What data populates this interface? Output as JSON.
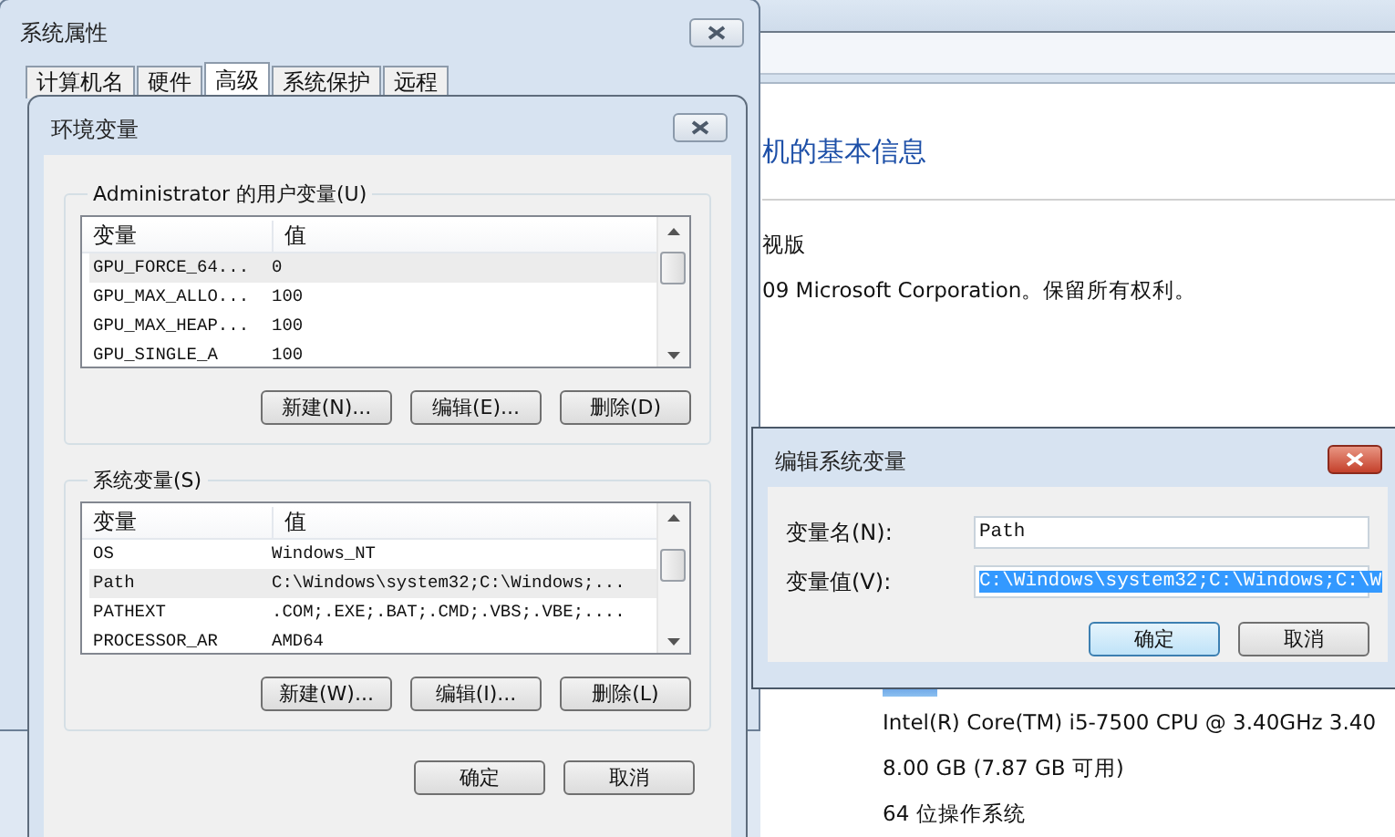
{
  "background_window": {
    "heading": "机的基本信息",
    "edition": "视版",
    "copyright": "09 Microsoft Corporation。保留所有权利。",
    "specs": [
      "Intel(R) Core(TM) i5-7500 CPU @ 3.40GHz   3.40",
      "8.00 GB (7.87 GB 可用)",
      "64 位操作系统"
    ]
  },
  "system_properties": {
    "title": "系统属性",
    "tabs": [
      {
        "label": "计算机名",
        "selected": false
      },
      {
        "label": "硬件",
        "selected": false
      },
      {
        "label": "高级",
        "selected": true
      },
      {
        "label": "系统保护",
        "selected": false
      },
      {
        "label": "远程",
        "selected": false
      }
    ]
  },
  "environment_variables": {
    "title": "环境变量",
    "groups": [
      {
        "title": "Administrator 的用户变量(U)",
        "columns": [
          "变量",
          "值"
        ],
        "rows": [
          {
            "name": "GPU_FORCE_64...",
            "value": "0",
            "selected": true
          },
          {
            "name": "GPU_MAX_ALLO...",
            "value": "100",
            "selected": false
          },
          {
            "name": "GPU_MAX_HEAP...",
            "value": "100",
            "selected": false
          },
          {
            "name": "GPU_SINGLE_A",
            "value": "100",
            "selected": false
          }
        ],
        "buttons": [
          "新建(N)...",
          "编辑(E)...",
          "删除(D)"
        ]
      },
      {
        "title": "系统变量(S)",
        "columns": [
          "变量",
          "值"
        ],
        "rows": [
          {
            "name": "OS",
            "value": "Windows_NT",
            "selected": false
          },
          {
            "name": "Path",
            "value": "C:\\Windows\\system32;C:\\Windows;...",
            "selected": true
          },
          {
            "name": "PATHEXT",
            "value": ".COM;.EXE;.BAT;.CMD;.VBS;.VBE;....",
            "selected": false
          },
          {
            "name": "PROCESSOR_AR",
            "value": "AMD64",
            "selected": false
          }
        ],
        "buttons": [
          "新建(W)...",
          "编辑(I)...",
          "删除(L)"
        ]
      }
    ],
    "buttons": [
      "确定",
      "取消"
    ]
  },
  "edit_dialog": {
    "title": "编辑系统变量",
    "fields": [
      {
        "label": "变量名(N):",
        "value": "Path",
        "selected": false
      },
      {
        "label": "变量值(V):",
        "value": "C:\\Windows\\system32;C:\\Windows;C:\\W",
        "selected": true
      }
    ],
    "buttons": [
      {
        "label": "确定",
        "focused": true
      },
      {
        "label": "取消",
        "focused": false
      }
    ]
  }
}
